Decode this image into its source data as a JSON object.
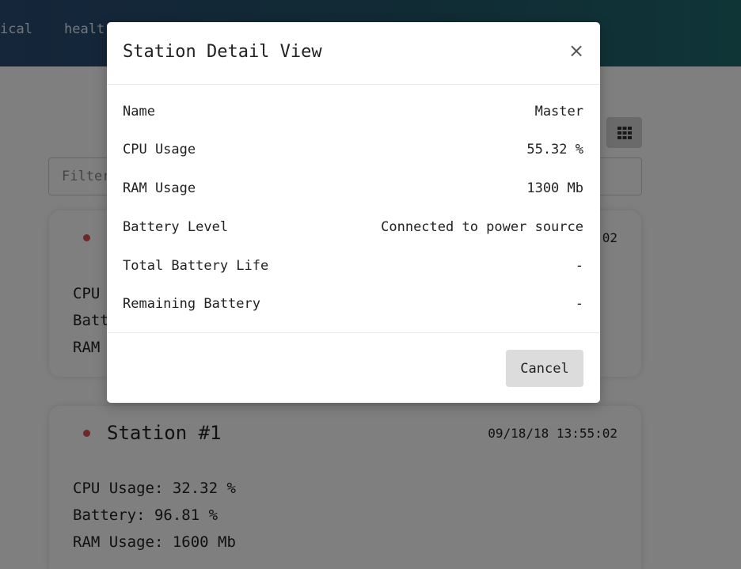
{
  "nav": {
    "items": [
      "ical",
      "healt"
    ]
  },
  "filter": {
    "placeholder": "Filter"
  },
  "cards": [
    {
      "station_name": "",
      "timestamp": "02",
      "metrics": [
        "CPU",
        "Batt",
        "RAM"
      ]
    },
    {
      "station_name": "Station #1",
      "timestamp": "09/18/18 13:55:02",
      "metrics": [
        "CPU Usage: 32.32 %",
        "Battery: 96.81 %",
        "RAM Usage: 1600 Mb"
      ]
    }
  ],
  "modal": {
    "title": "Station Detail View",
    "close_label": "×",
    "rows": [
      {
        "label": "Name",
        "value": "Master"
      },
      {
        "label": "CPU Usage",
        "value": "55.32 %"
      },
      {
        "label": "RAM Usage",
        "value": "1300 Mb"
      },
      {
        "label": "Battery Level",
        "value": "Connected to power source"
      },
      {
        "label": "Total Battery Life",
        "value": "-"
      },
      {
        "label": "Remaining Battery",
        "value": "-"
      }
    ],
    "cancel_label": "Cancel"
  },
  "colors": {
    "status_dot": "#d9534f",
    "overlay": "rgba(0,0,0,0.5)"
  }
}
